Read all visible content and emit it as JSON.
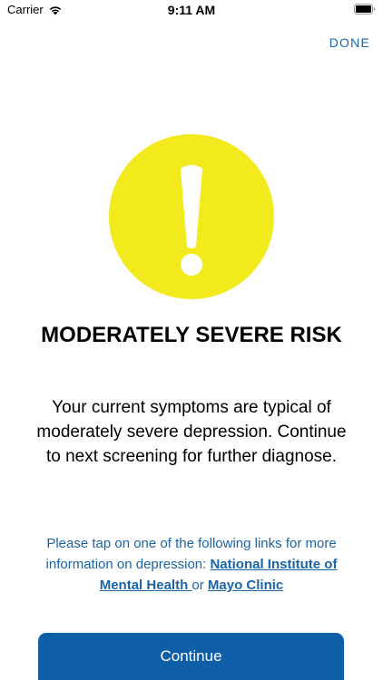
{
  "status_bar": {
    "carrier": "Carrier",
    "time": "9:11 AM",
    "icons": [
      "wifi-icon",
      "battery-icon"
    ]
  },
  "nav": {
    "done_label": "DONE"
  },
  "result": {
    "icon": "exclamation-icon",
    "icon_color": "#f2ea1d",
    "title": "MODERATELY SEVERE RISK",
    "description": "Your current symptoms are typical of moderately severe depression. Continue to next screening for further diagnose."
  },
  "info": {
    "intro": "Please tap on one of the following links for more information on depression: ",
    "link_nimh": "National Institute of Mental Health ",
    "separator": "or ",
    "link_mayo": "Mayo Clinic"
  },
  "actions": {
    "continue_label": "Continue"
  },
  "colors": {
    "accent": "#1a64a6",
    "button": "#0f5fa8",
    "warning": "#f2ea1d"
  }
}
